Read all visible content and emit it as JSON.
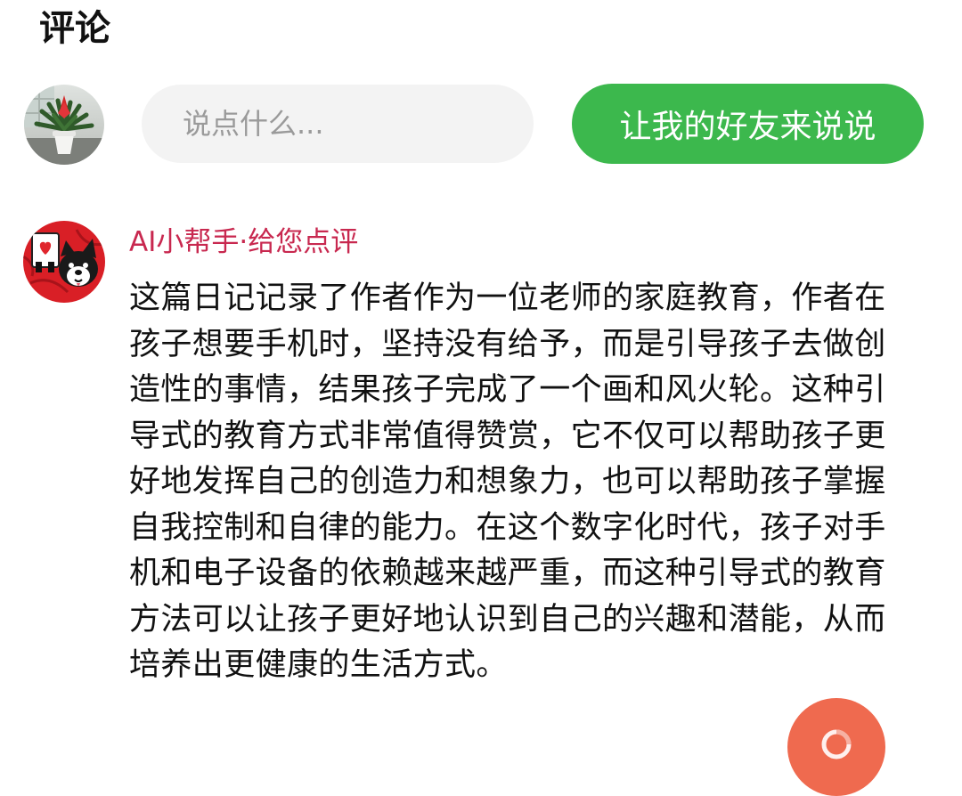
{
  "section": {
    "title": "评论"
  },
  "composer": {
    "placeholder": "说点什么...",
    "friend_button_label": "让我的好友来说说"
  },
  "comment": {
    "author": "AI小帮手·给您点评",
    "text": "这篇日记记录了作者作为一位老师的家庭教育，作者在孩子想要手机时，坚持没有给予，而是引导孩子去做创造性的事情，结果孩子完成了一个画和风火轮。这种引导式的教育方式非常值得赞赏，它不仅可以帮助孩子更好地发挥自己的创造力和想象力，也可以帮助孩子掌握自我控制和自律的能力。在这个数字化时代，孩子对手机和电子设备的依赖越来越严重，而这种引导式的教育方法可以让孩子更好地认识到自己的兴趣和潜能，从而培养出更健康的生活方式。"
  },
  "colors": {
    "accent_green": "#3cb84d",
    "author_name": "#c8284f",
    "fab": "#ef6a4f",
    "input_bg": "#f3f3f3"
  },
  "icons": {
    "user_avatar": "potted-plant-photo",
    "ai_avatar": "cartoon-dog-heart",
    "fab": "swirl-icon"
  }
}
